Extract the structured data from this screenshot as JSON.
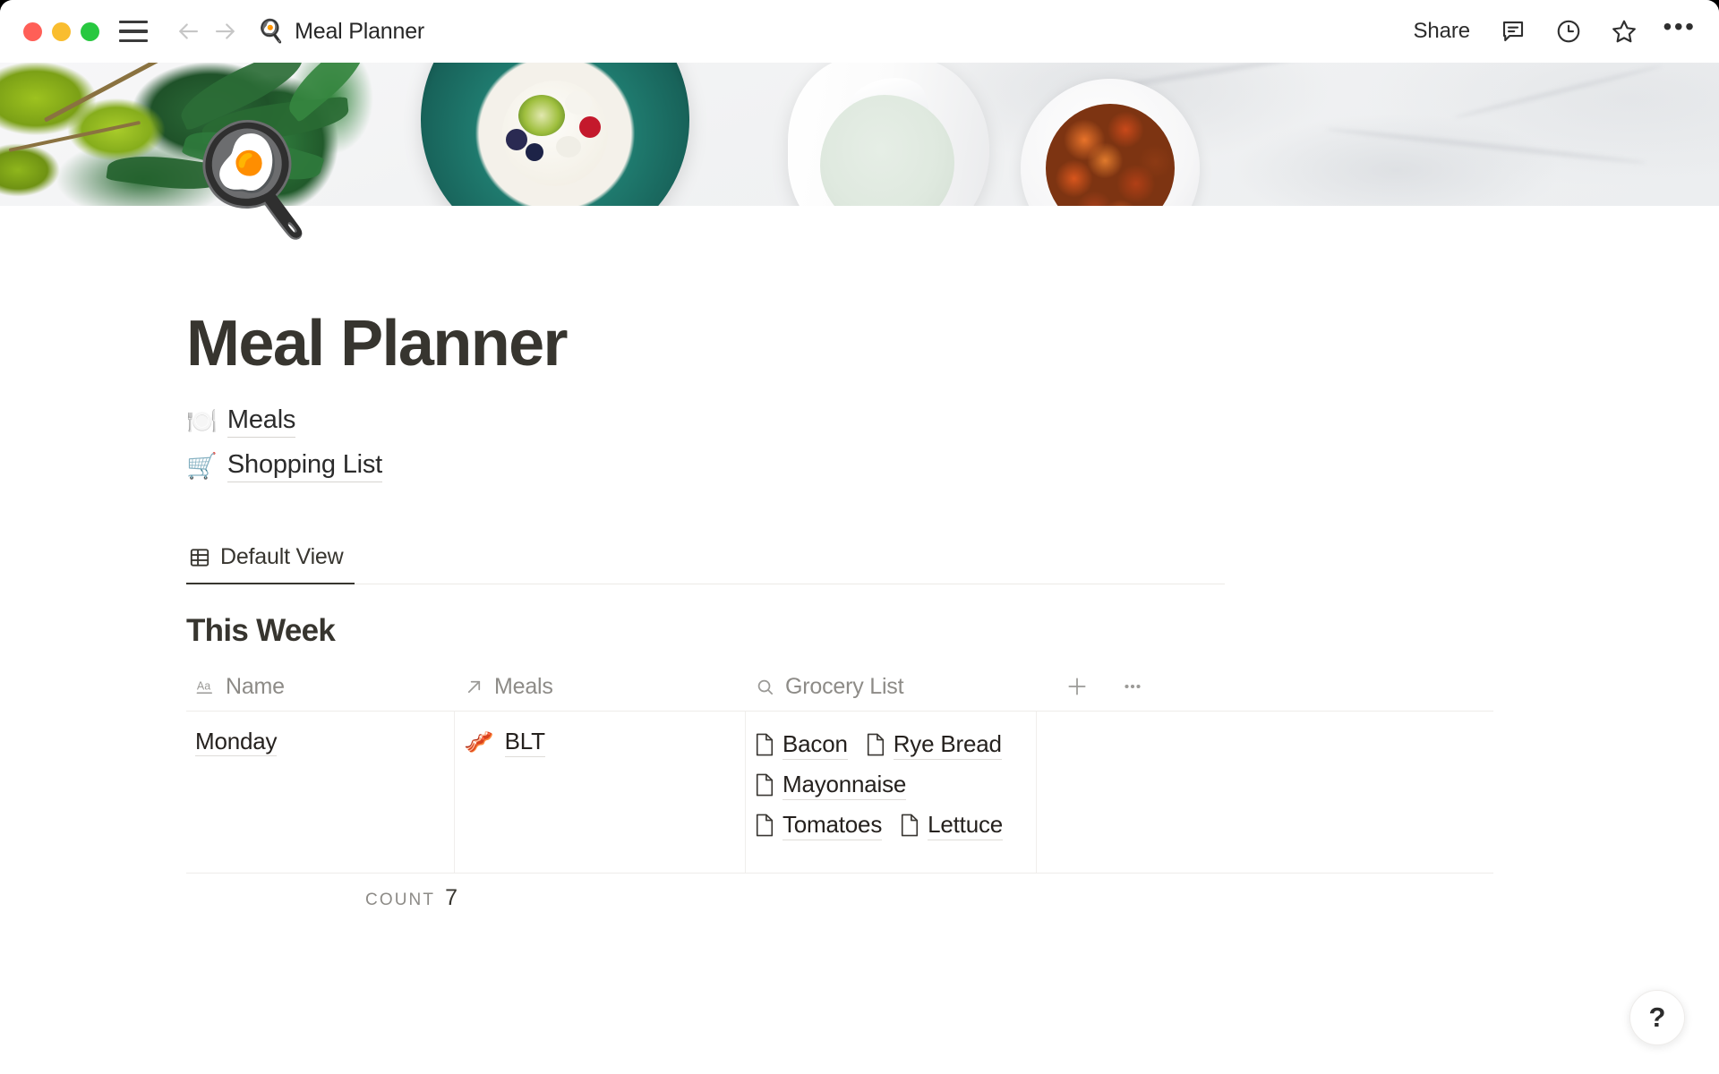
{
  "window": {
    "traffic_lights": [
      "close",
      "minimize",
      "zoom"
    ],
    "menu_icon": "hamburger-icon",
    "back_icon": "arrow-left-icon",
    "forward_icon": "arrow-right-icon",
    "breadcrumb_emoji": "🍳",
    "breadcrumb_title": "Meal Planner",
    "toolbar": {
      "share_label": "Share",
      "comment_icon": "comment-icon",
      "history_icon": "clock-icon",
      "favorite_icon": "star-icon",
      "more_icon": "ellipsis-icon"
    }
  },
  "page": {
    "cover_alt": "food-flatlay-cover",
    "icon_emoji": "🍳",
    "title": "Meal Planner",
    "sublinks": [
      {
        "emoji": "🍽️",
        "label": "Meals",
        "name": "meals"
      },
      {
        "emoji": "🛒",
        "label": "Shopping List",
        "name": "shopping-list"
      }
    ]
  },
  "database": {
    "view_tab": {
      "label": "Default View",
      "icon": "table-icon"
    },
    "group_title": "This Week",
    "columns": [
      {
        "key": "name",
        "label": "Name",
        "icon": "text-type-icon"
      },
      {
        "key": "meals",
        "label": "Meals",
        "icon": "relation-arrow-icon"
      },
      {
        "key": "grocery",
        "label": "Grocery List",
        "icon": "rollup-search-icon"
      }
    ],
    "header_actions": {
      "add_column": "+",
      "more": "ellipsis-icon"
    },
    "rows": [
      {
        "name": "Monday",
        "meals": [
          {
            "emoji": "🥓",
            "label": "BLT"
          }
        ],
        "grocery": [
          "Bacon",
          "Rye Bread",
          "Mayonnaise",
          "Tomatoes",
          "Lettuce"
        ]
      }
    ],
    "footer": {
      "count_label": "Count",
      "count_value": "7"
    }
  },
  "help": {
    "label": "?"
  },
  "colors": {
    "text_primary": "#37352f",
    "text_muted": "#8d8b87",
    "border": "#eeecea",
    "traffic_red": "#ff5f57",
    "traffic_yellow": "#f9bd2f",
    "traffic_green": "#28c840"
  }
}
